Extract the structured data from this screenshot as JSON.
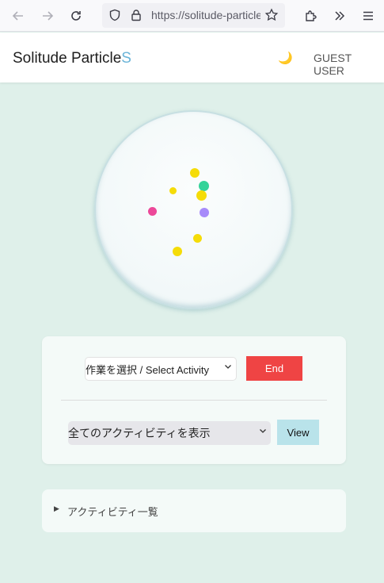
{
  "browser": {
    "url": "https://solitude-particles",
    "icons": {
      "back": "arrow-left-icon",
      "forward": "arrow-right-icon",
      "reload": "reload-icon",
      "shield": "shield-icon",
      "lock": "lock-icon",
      "bookmark": "star-icon",
      "extensions": "puzzle-icon",
      "overflow": "double-chevron-icon",
      "menu": "hamburger-icon"
    }
  },
  "header": {
    "brand_main": "Solitude Particle",
    "brand_accent": "S",
    "theme_toggle": "🌙",
    "user_label": "GUEST USER"
  },
  "particles": [
    {
      "color": "#f5dc08"
    },
    {
      "color": "#34d399"
    },
    {
      "color": "#f5dc08"
    },
    {
      "color": "#f5dc08"
    },
    {
      "color": "#ec4899"
    },
    {
      "color": "#a78bfa"
    },
    {
      "color": "#f5dc08"
    },
    {
      "color": "#f5dc08"
    }
  ],
  "controls": {
    "activity_select": "作業を選択 / Select Activity",
    "end_button": "End",
    "filter_select": "全てのアクティビティを表示",
    "view_button": "View"
  },
  "details": {
    "summary": "アクティビティ一覧"
  },
  "colors": {
    "background": "#dff0ea",
    "accent": "#6ab4d8",
    "end": "#ef4444",
    "view": "#b9e3ea"
  }
}
